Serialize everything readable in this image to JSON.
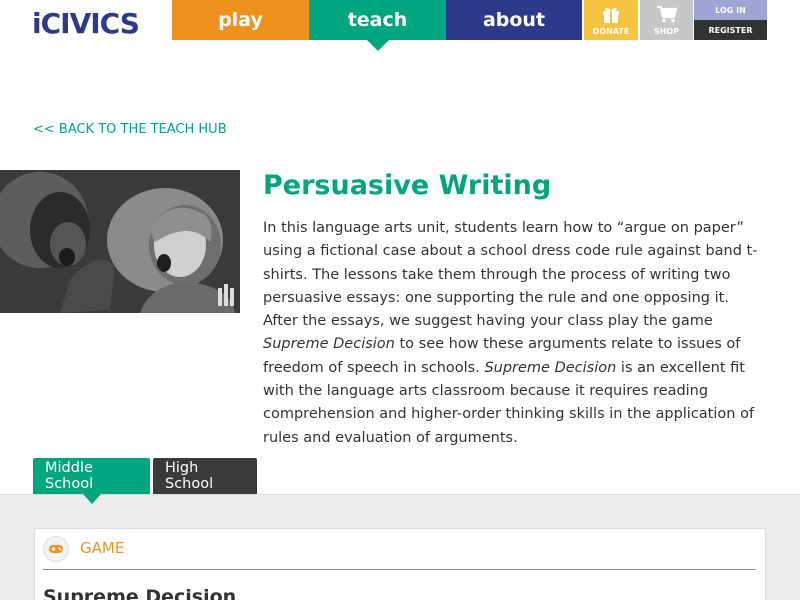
{
  "header": {
    "logo_text": "iCIVICS",
    "nav": [
      {
        "label": "play"
      },
      {
        "label": "teach"
      },
      {
        "label": "about"
      }
    ],
    "donate_label": "DONATE",
    "shop_label": "SHOP",
    "login_label": "LOG IN",
    "register_label": "REGISTER",
    "colors": {
      "play": "#f0911d",
      "teach": "#00a67e",
      "about": "#2d3a8c"
    }
  },
  "back_link": "<< BACK TO THE TEACH HUB",
  "unit": {
    "title": "Persuasive Writing",
    "desc_1": "In this language arts unit, students learn how to “argue on paper” using a fictional case about a school dress code rule against band t-shirts. The lessons take them through the process of writing two persuasive essays: one supporting the rule and one opposing it. After the essays, we suggest having your class play the game ",
    "desc_game_1": "Supreme Decision",
    "desc_2": " to see how these arguments relate to issues of freedom of speech in schools. ",
    "desc_game_2": "Supreme Decision",
    "desc_3": " is an excellent fit with the language arts classroom because it requires reading comprehension and higher-order thinking skills in the application of rules and evaluation of arguments."
  },
  "tabs": [
    {
      "label": "Middle School",
      "active": true
    },
    {
      "label": "High School",
      "active": false
    }
  ],
  "card": {
    "type_label": "GAME",
    "icon": "gamepad-icon",
    "title": "Supreme Decision"
  }
}
